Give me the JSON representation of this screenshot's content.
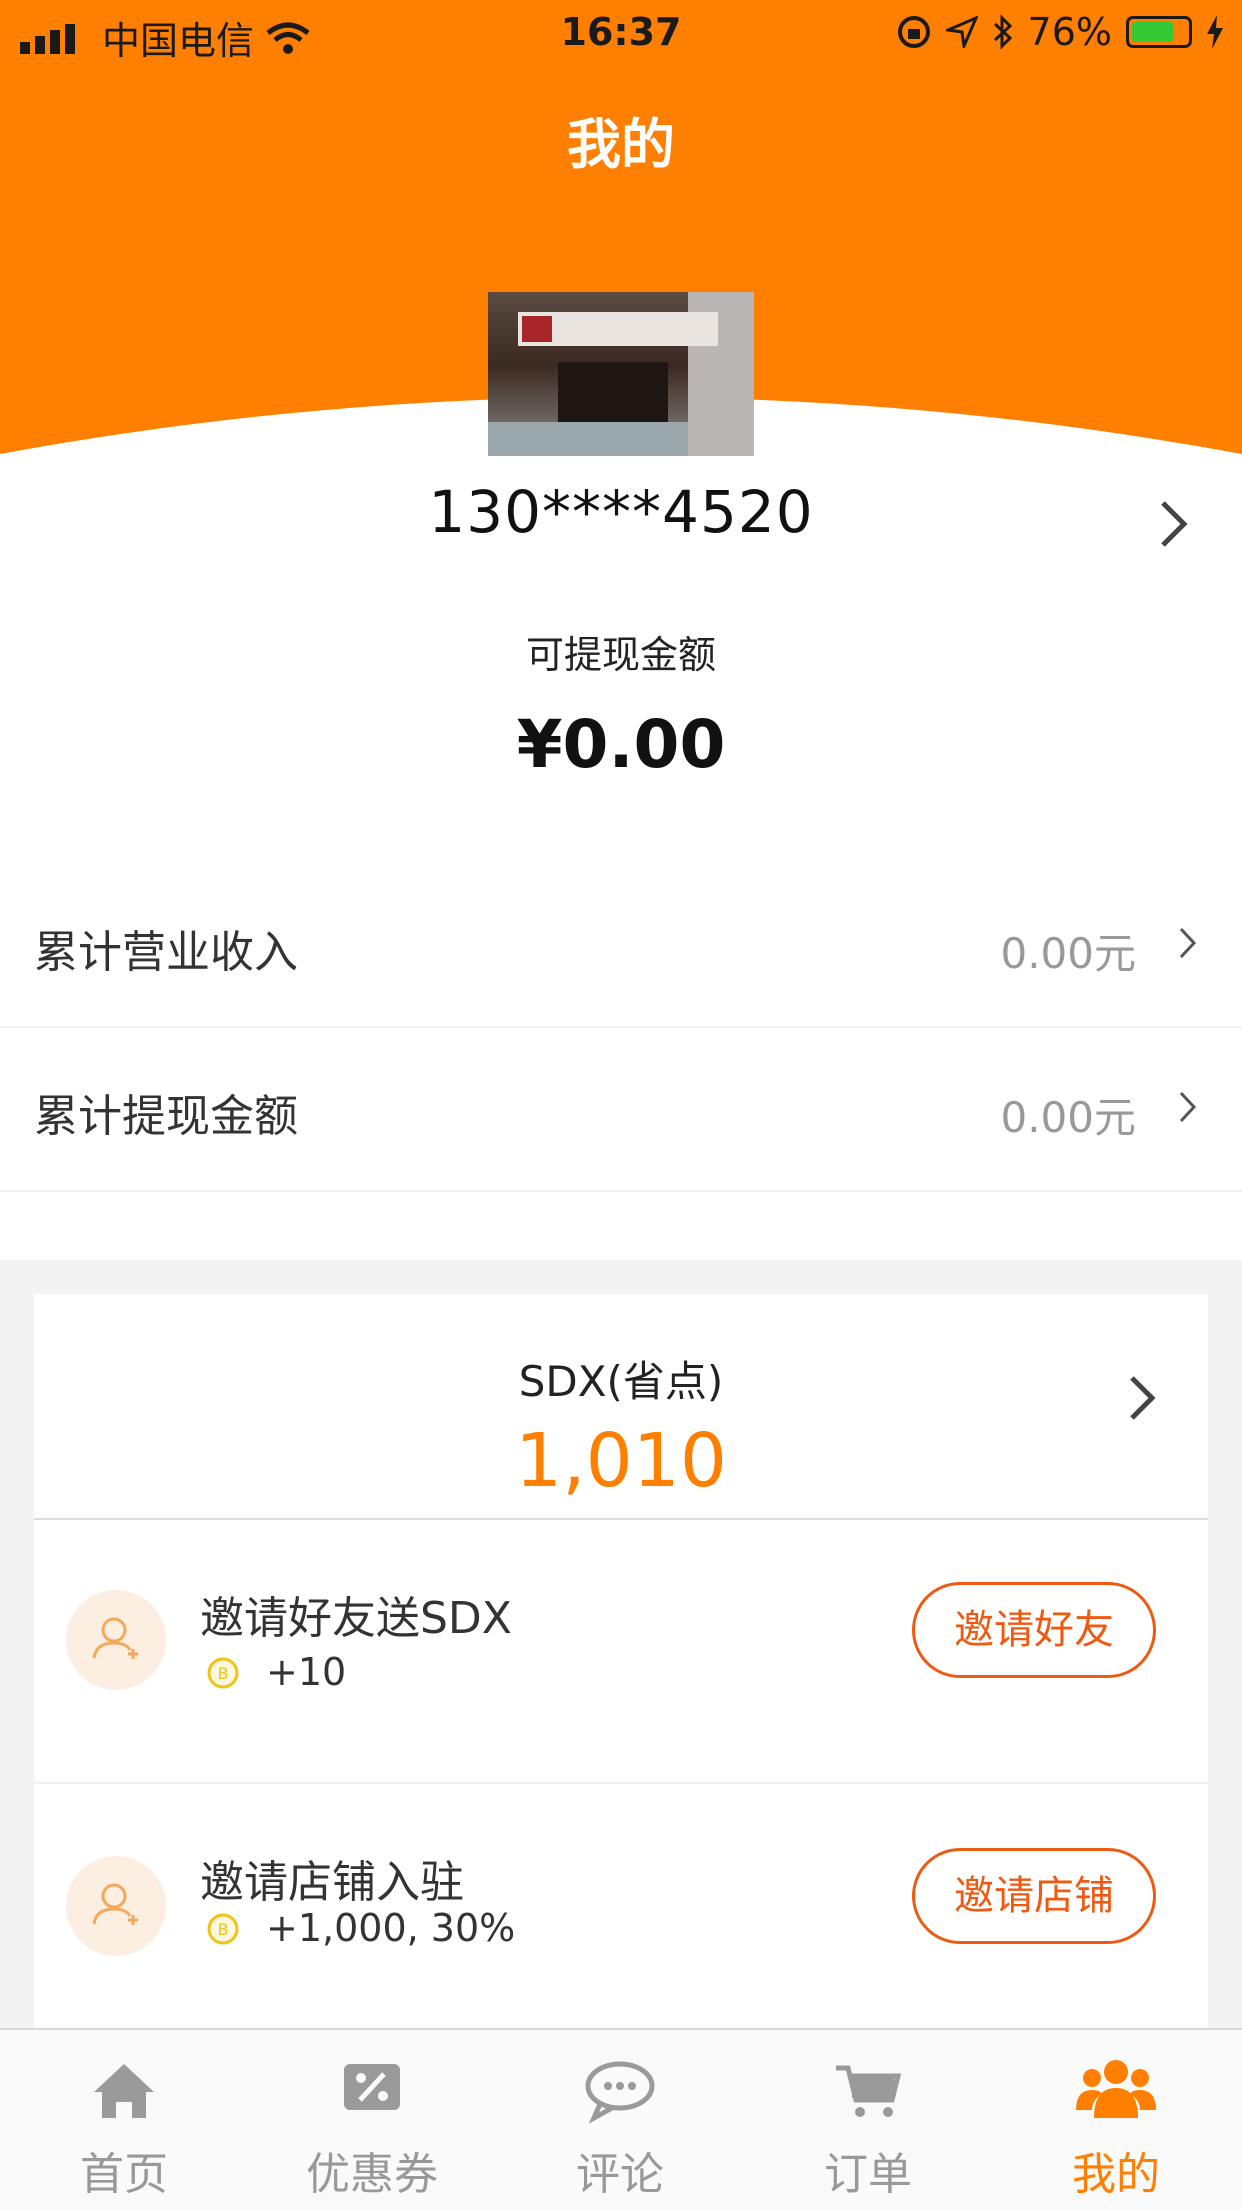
{
  "status_bar": {
    "carrier": "中国电信",
    "time": "16:37",
    "battery": "76%",
    "battery_level": 0.76
  },
  "header": {
    "title": "我的"
  },
  "profile": {
    "phone": "130****4520",
    "withdraw_label": "可提现金额",
    "withdraw_amount": "¥0.00"
  },
  "stats": [
    {
      "label": "累计营业收入",
      "value": "0.00元"
    },
    {
      "label": "累计提现金额",
      "value": "0.00元"
    }
  ],
  "sdx": {
    "title": "SDX(省点)",
    "value": "1,010"
  },
  "tasks": [
    {
      "title": "邀请好友送SDX",
      "reward": "+10",
      "button": "邀请好友"
    },
    {
      "title": "邀请店铺入驻",
      "reward": "+1,000, 30%",
      "button": "邀请店铺"
    }
  ],
  "tabbar": {
    "items": [
      {
        "label": "首页",
        "icon": "home-icon"
      },
      {
        "label": "优惠券",
        "icon": "coupon-icon"
      },
      {
        "label": "评论",
        "icon": "comment-icon"
      },
      {
        "label": "订单",
        "icon": "cart-icon"
      },
      {
        "label": "我的",
        "icon": "users-icon"
      }
    ],
    "active_index": 4
  },
  "colors": {
    "brand": "#ff7f00",
    "button": "#ef5a12",
    "muted": "#999999"
  }
}
